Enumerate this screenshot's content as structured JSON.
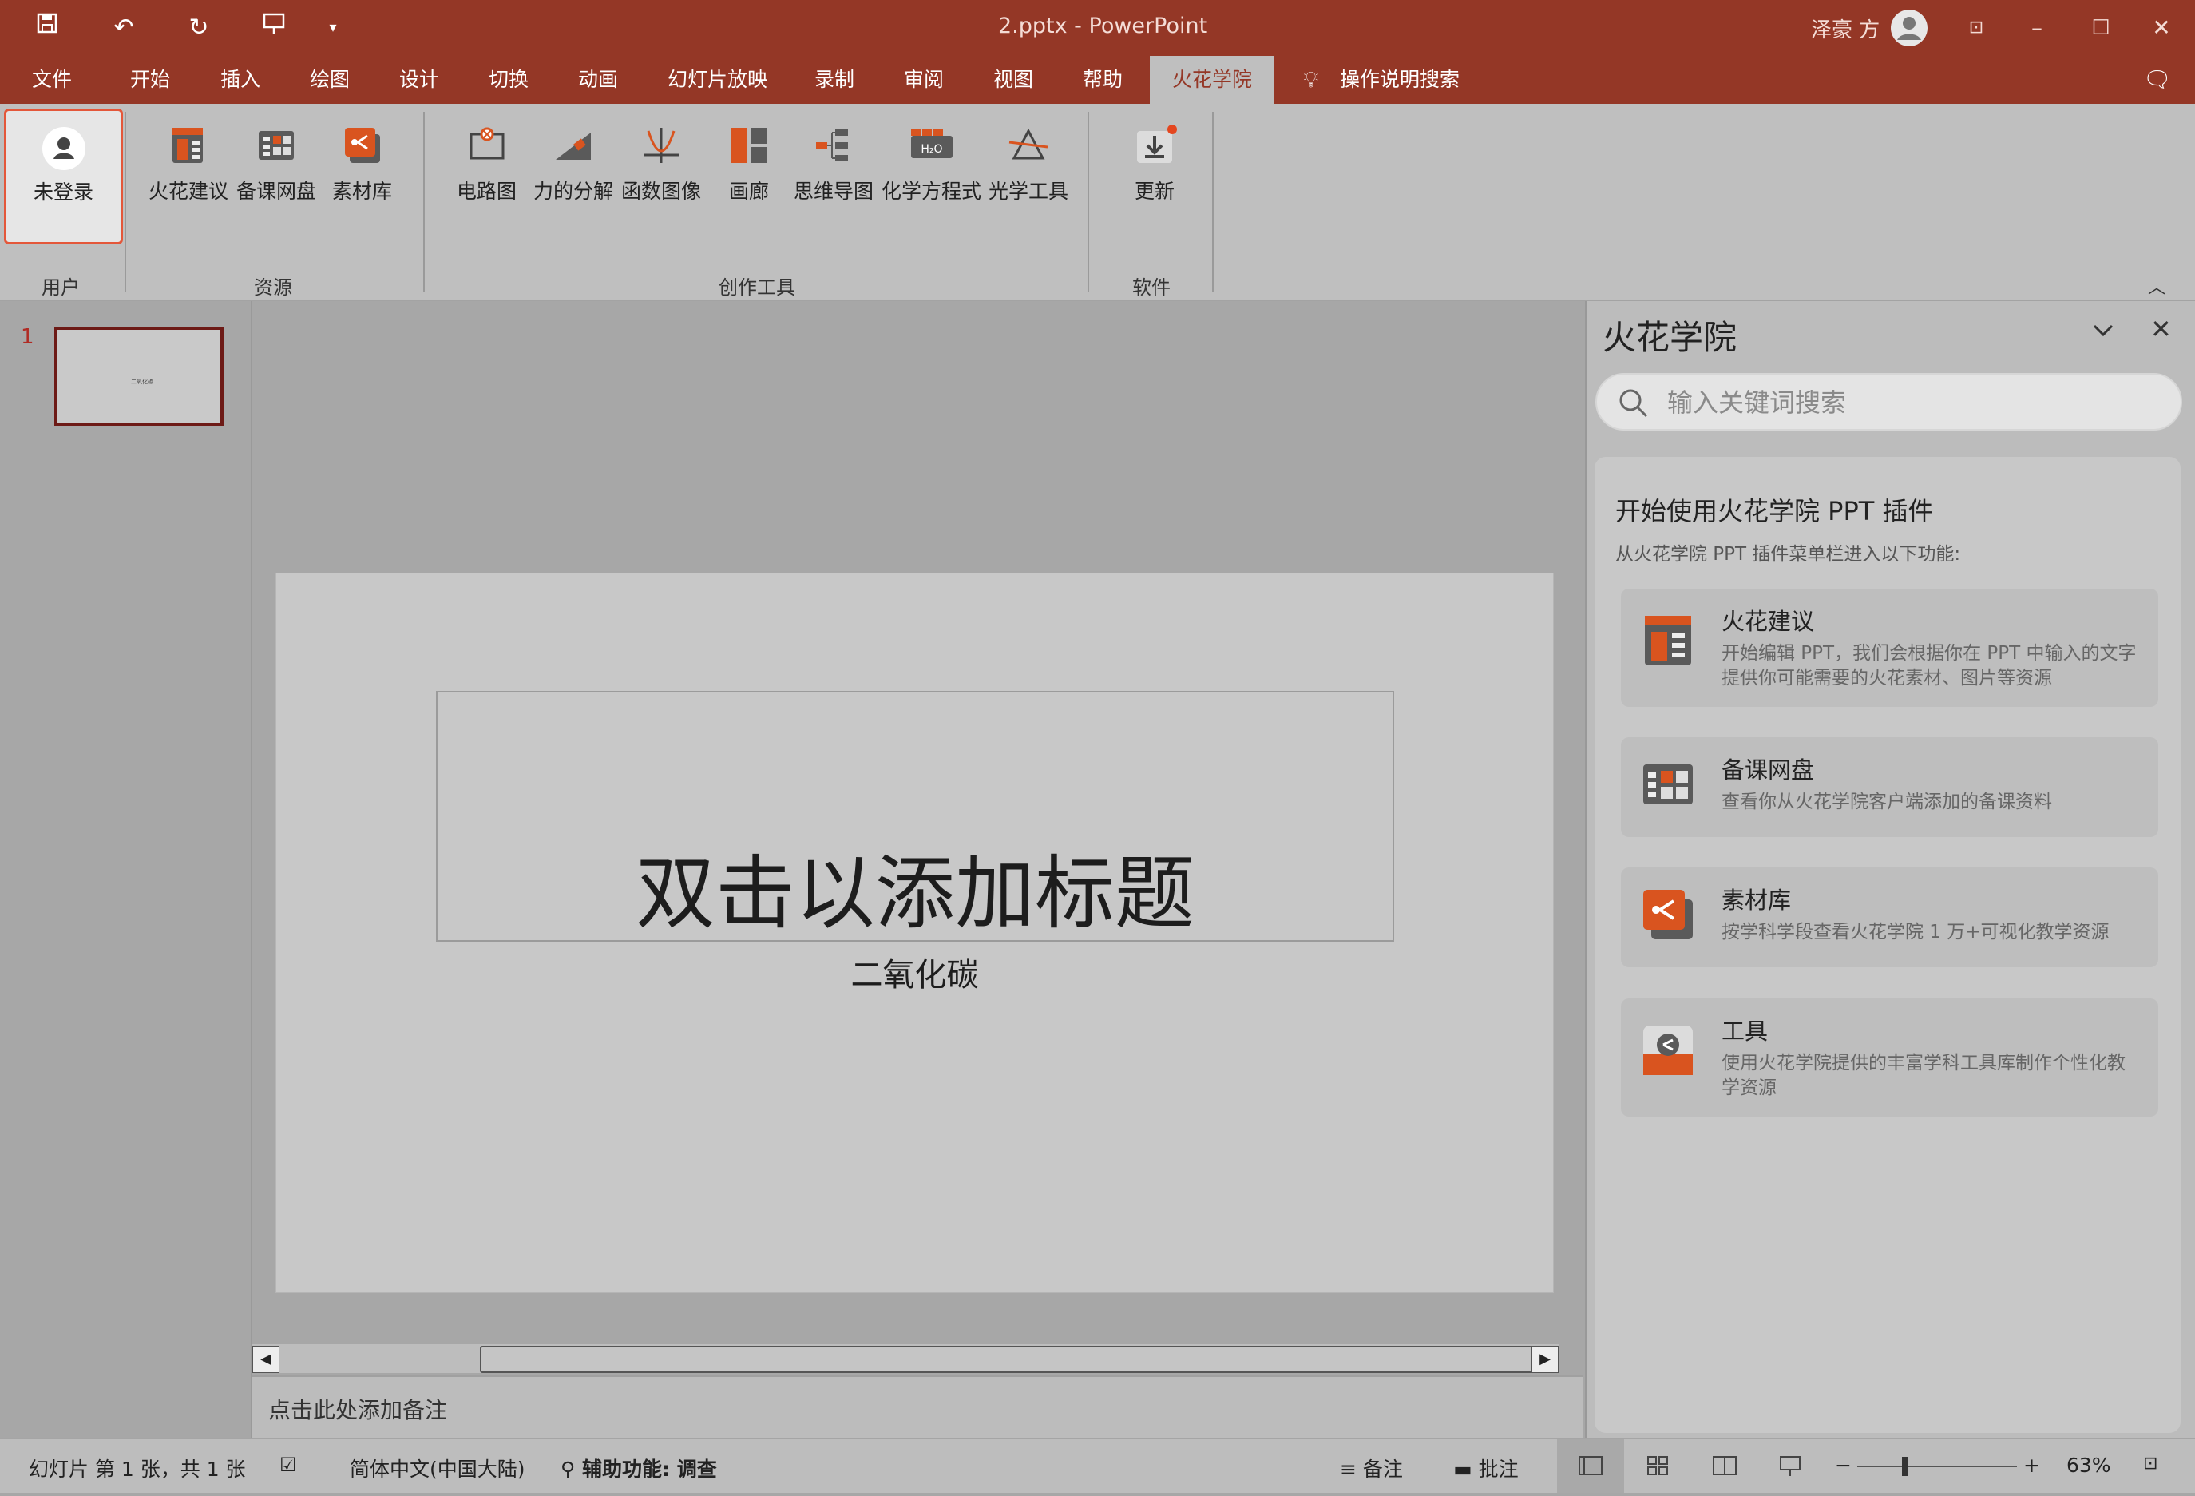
{
  "window": {
    "doc_title": "2.pptx  -  PowerPoint",
    "user_name": "泽豪 方"
  },
  "quick_access": [
    "save-icon",
    "undo-icon",
    "redo-icon",
    "present-icon",
    "customize-icon"
  ],
  "tabs": [
    {
      "label": "文件"
    },
    {
      "label": "开始"
    },
    {
      "label": "插入"
    },
    {
      "label": "绘图"
    },
    {
      "label": "设计"
    },
    {
      "label": "切换"
    },
    {
      "label": "动画"
    },
    {
      "label": "幻灯片放映"
    },
    {
      "label": "录制"
    },
    {
      "label": "审阅"
    },
    {
      "label": "视图"
    },
    {
      "label": "帮助"
    },
    {
      "label": "火花学院",
      "active": true
    }
  ],
  "tell_me": "操作说明搜索",
  "ribbon": {
    "login": "未登录",
    "groups": {
      "user": "用户",
      "resources": "资源",
      "tools": "创作工具",
      "software": "软件"
    },
    "buttons": {
      "suggest": "火花建议",
      "disk": "备课网盘",
      "library": "素材库",
      "circuit": "电路图",
      "force": "力的分解",
      "func": "函数图像",
      "gallery": "画廊",
      "mindmap": "思维导图",
      "chem": "化学方程式",
      "optics": "光学工具",
      "update": "更新"
    }
  },
  "thumbnails": [
    {
      "number": "1",
      "mini_title": "二氧化碳"
    }
  ],
  "slide": {
    "title": "双击以添加标题",
    "subtitle": "二氧化碳"
  },
  "notes_placeholder": "点击此处添加备注",
  "taskpane": {
    "title": "火花学院",
    "search_placeholder": "输入关键词搜索",
    "heading": "开始使用火花学院 PPT 插件",
    "subheading": "从火花学院 PPT 插件菜单栏进入以下功能:",
    "features": [
      {
        "title": "火花建议",
        "desc": "开始编辑 PPT，我们会根据你在 PPT 中输入的文字提供你可能需要的火花素材、图片等资源"
      },
      {
        "title": "备课网盘",
        "desc": "查看你从火花学院客户端添加的备课资料"
      },
      {
        "title": "素材库",
        "desc": "按学科学段查看火花学院 1 万+可视化教学资源"
      },
      {
        "title": "工具",
        "desc": "使用火花学院提供的丰富学科工具库制作个性化教学资源"
      }
    ]
  },
  "status": {
    "slide_info": "幻灯片 第 1 张，共 1 张",
    "language": "简体中文(中国大陆)",
    "accessibility": "辅助功能: 调查",
    "notes": "备注",
    "comments": "批注",
    "zoom": "63%",
    "zoom_level": 0.63
  },
  "colors": {
    "accent": "#943726",
    "icon_orange": "#d9541f",
    "icon_gray": "#5a5a5a"
  }
}
